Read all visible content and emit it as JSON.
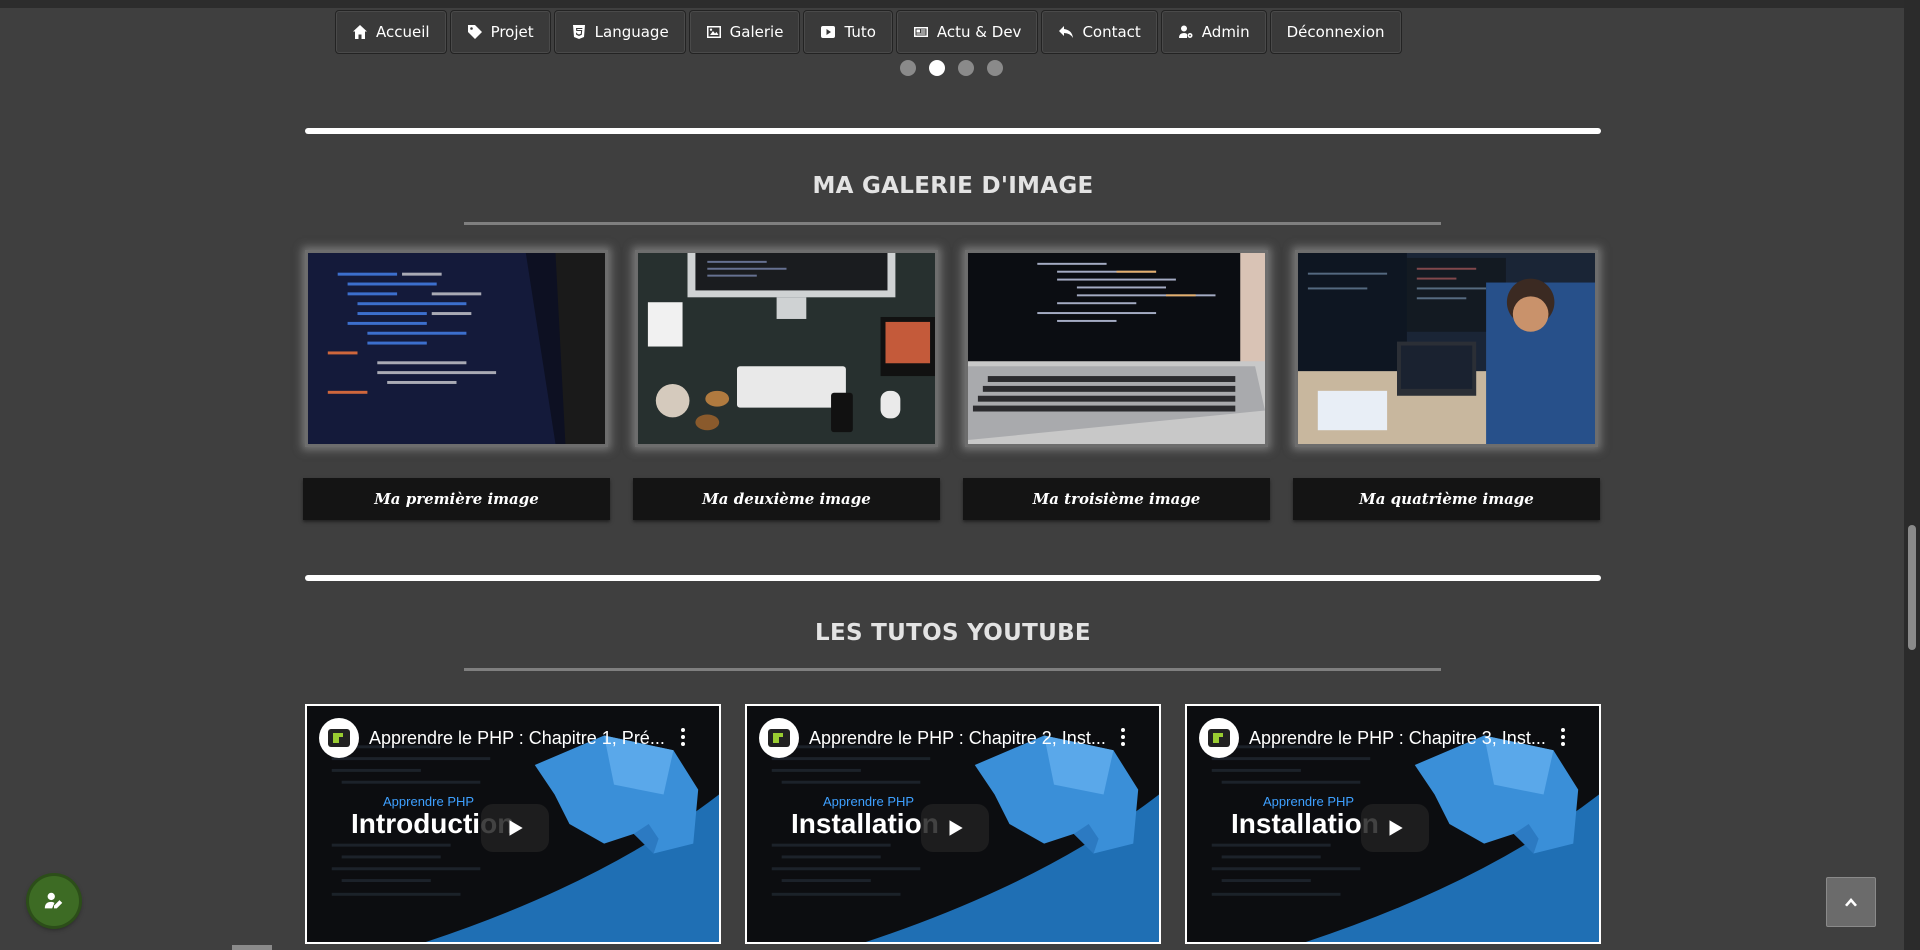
{
  "nav": {
    "items": [
      {
        "label": "Accueil",
        "icon": "home-icon"
      },
      {
        "label": "Projet",
        "icon": "tag-icon"
      },
      {
        "label": "Language",
        "icon": "html5-icon"
      },
      {
        "label": "Galerie",
        "icon": "image-icon"
      },
      {
        "label": "Tuto",
        "icon": "youtube-icon"
      },
      {
        "label": "Actu & Dev",
        "icon": "newspaper-icon"
      },
      {
        "label": "Contact",
        "icon": "reply-icon"
      },
      {
        "label": "Admin",
        "icon": "user-cog-icon"
      },
      {
        "label": "Déconnexion",
        "icon": ""
      }
    ]
  },
  "carousel": {
    "dot_count": 4,
    "active_index": 1
  },
  "gallery": {
    "title": "MA GALERIE D'IMAGE",
    "items": [
      {
        "caption": "Ma première image"
      },
      {
        "caption": "Ma deuxième image"
      },
      {
        "caption": "Ma troisième image"
      },
      {
        "caption": "Ma quatrième image"
      }
    ]
  },
  "tutos": {
    "title": "LES TUTOS YOUTUBE",
    "videos": [
      {
        "title": "Apprendre le PHP : Chapitre 1, Pré...",
        "subtitle": "Apprendre PHP",
        "overlay": "Introduction"
      },
      {
        "title": "Apprendre le PHP : Chapitre 2, Inst...",
        "subtitle": "Apprendre PHP",
        "overlay": "Installation"
      },
      {
        "title": "Apprendre le PHP : Chapitre 3, Inst...",
        "subtitle": "Apprendre PHP",
        "overlay": "Installation"
      }
    ]
  },
  "colors": {
    "page_bg": "#3f3f3f",
    "nav_bg": "#3a3a3a",
    "caption_bg": "#141414",
    "fab_green": "#3d6b24",
    "video_blue": "#1f6fb4"
  }
}
